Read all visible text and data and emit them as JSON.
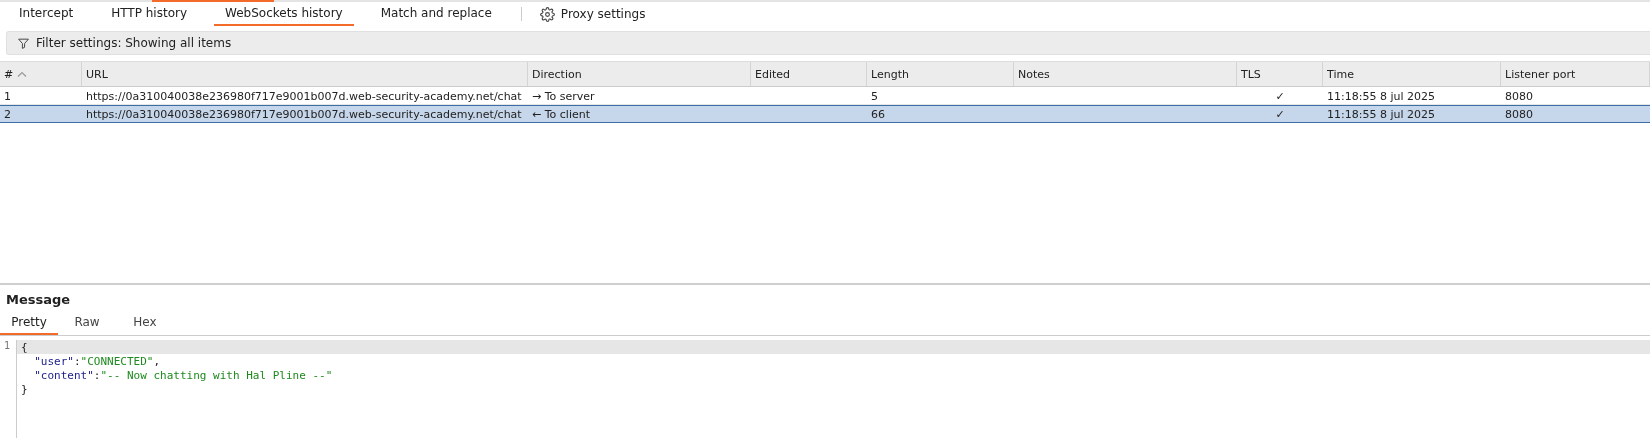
{
  "tabs": [
    {
      "label": "Intercept",
      "selected": false
    },
    {
      "label": "HTTP history",
      "selected": false
    },
    {
      "label": "WebSockets history",
      "selected": true
    },
    {
      "label": "Match and replace",
      "selected": false
    }
  ],
  "settings_button": {
    "label": "Proxy settings"
  },
  "filter": {
    "label": "Filter settings: Showing all items"
  },
  "table": {
    "columns": [
      {
        "label": "#",
        "sorted": true
      },
      {
        "label": "URL",
        "sorted": false
      },
      {
        "label": "Direction",
        "sorted": false
      },
      {
        "label": "Edited",
        "sorted": false
      },
      {
        "label": "Length",
        "sorted": false
      },
      {
        "label": "Notes",
        "sorted": false
      },
      {
        "label": "TLS",
        "sorted": false
      },
      {
        "label": "Time",
        "sorted": false
      },
      {
        "label": "Listener port",
        "sorted": false
      }
    ],
    "rows": [
      {
        "selected": false,
        "cells": [
          "1",
          "https://0a310040038e236980f717e9001b007d.web-security-academy.net/chat",
          "→ To server",
          "",
          "5",
          "",
          "✓",
          "11:18:55 8 jul 2025",
          "8080"
        ]
      },
      {
        "selected": true,
        "cells": [
          "2",
          "https://0a310040038e236980f717e9001b007d.web-security-academy.net/chat",
          "← To client",
          "",
          "66",
          "",
          "✓",
          "11:18:55 8 jul 2025",
          "8080"
        ]
      }
    ]
  },
  "message": {
    "title": "Message",
    "tabs": [
      {
        "label": "Pretty",
        "selected": true
      },
      {
        "label": "Raw",
        "selected": false
      },
      {
        "label": "Hex",
        "selected": false
      }
    ],
    "lines": [
      {
        "number": "1",
        "highlighted": true,
        "tokens": [
          {
            "kind": "punct",
            "text": "{"
          }
        ]
      },
      {
        "highlighted": false,
        "tokens": [
          {
            "kind": "key",
            "text": "  \"user\""
          },
          {
            "kind": "punct",
            "text": ":"
          },
          {
            "kind": "string",
            "text": "\"CONNECTED\""
          },
          {
            "kind": "punct",
            "text": ","
          }
        ]
      },
      {
        "highlighted": false,
        "tokens": [
          {
            "kind": "key",
            "text": "  \"content\""
          },
          {
            "kind": "punct",
            "text": ":"
          },
          {
            "kind": "string",
            "text": "\"-- Now chatting with Hal Pline --\""
          }
        ]
      },
      {
        "highlighted": false,
        "tokens": [
          {
            "kind": "punct",
            "text": "}"
          }
        ]
      }
    ]
  }
}
